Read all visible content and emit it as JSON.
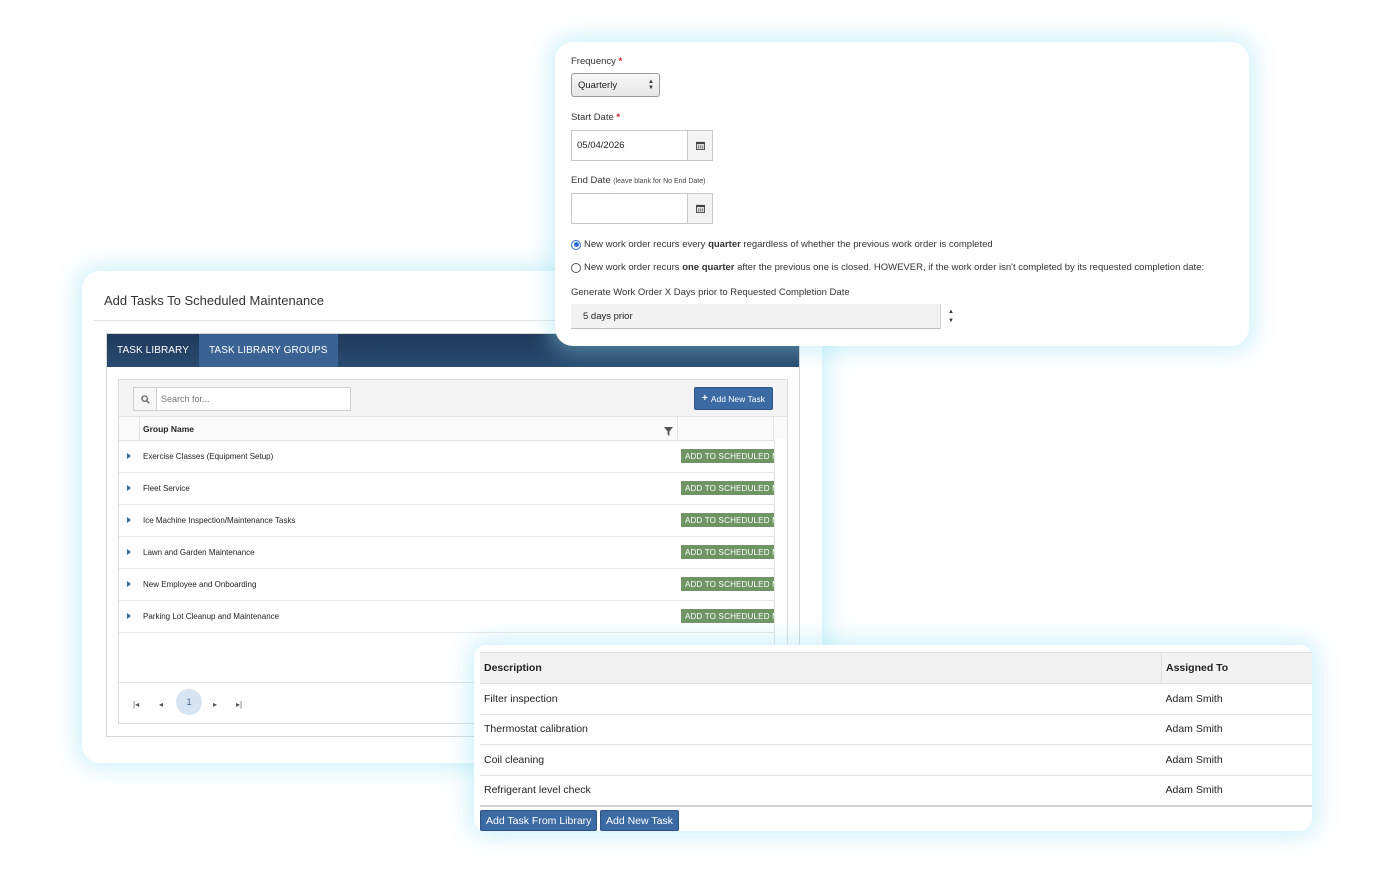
{
  "task_library_panel": {
    "title": "Add Tasks To Scheduled Maintenance",
    "tabs": [
      {
        "label": "TASK LIBRARY",
        "active": false
      },
      {
        "label": "TASK LIBRARY GROUPS",
        "active": true
      }
    ],
    "search_placeholder": "Search for...",
    "add_new_task_label": "Add New Task",
    "column_header": "Group Name",
    "add_button_label": "ADD TO SCHEDULED MAINTENANCE",
    "groups": [
      "Exercise Classes (Equipment Setup)",
      "Fleet Service",
      "Ice Machine Inspection/Maintenance Tasks",
      "Lawn and Garden Maintenance",
      "New Employee and Onboarding",
      "Parking Lot Cleanup and Maintenance"
    ],
    "pager": {
      "current_page": "1"
    },
    "colors": {
      "tab_bar": "#1f3a5b",
      "active_tab": "#3a6293",
      "add_button": "#6f9565",
      "primary": "#3c6aa3"
    }
  },
  "schedule_panel": {
    "frequency_label": "Frequency",
    "frequency_value": "Quarterly",
    "start_date_label": "Start Date",
    "start_date_value": "05/04/2026",
    "end_date_label": "End Date",
    "end_date_hint": "(leave blank for No End Date)",
    "end_date_value": "",
    "required_marker": "*",
    "recurrence_options": [
      {
        "prefix": "New work order recurs every ",
        "bold": "quarter",
        "suffix": " regardless of whether the previous work order is completed",
        "selected": true
      },
      {
        "prefix": "New work order recurs ",
        "bold": "one quarter",
        "suffix": " after the previous one is closed. HOWEVER, if the work order isn't completed by its requested completion date:",
        "selected": false
      }
    ],
    "generate_label": "Generate Work Order X Days prior to Requested Completion Date",
    "generate_value": "5 days prior"
  },
  "tasks_table": {
    "headers": {
      "description": "Description",
      "assigned_to": "Assigned To"
    },
    "rows": [
      {
        "description": "Filter inspection",
        "assigned_to": "Adam Smith"
      },
      {
        "description": "Thermostat calibration",
        "assigned_to": "Adam Smith"
      },
      {
        "description": "Coil cleaning",
        "assigned_to": "Adam Smith"
      },
      {
        "description": "Refrigerant level check",
        "assigned_to": "Adam Smith"
      }
    ],
    "buttons": {
      "from_library": "Add Task From Library",
      "new_task": "Add New Task"
    }
  }
}
